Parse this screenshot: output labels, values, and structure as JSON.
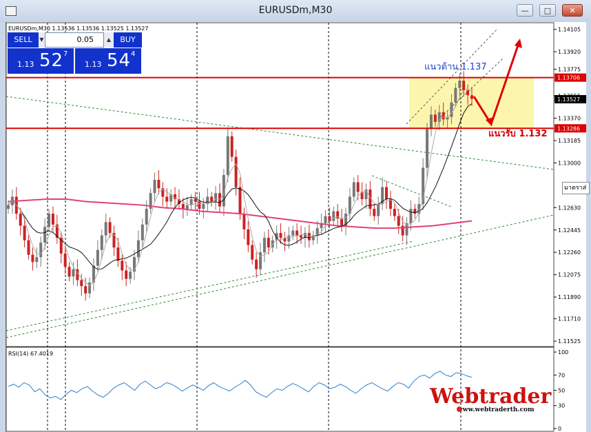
{
  "window": {
    "title": "EURUSDm,M30"
  },
  "trade_panel": {
    "sell_label": "SELL",
    "buy_label": "BUY",
    "lot_value": "0.05",
    "sell_price_small": "1.13",
    "sell_price_big": "52",
    "sell_price_sup": "7",
    "buy_price_small": "1.13",
    "buy_price_big": "54",
    "buy_price_sup": "4"
  },
  "chart_header": "EURUSDm,M30  1.13536 1.13536 1.13525 1.13527",
  "rsi_header": "RSI(14) 67.4019",
  "tooltip_text": "มาตราส่",
  "annotations": {
    "resistance": "แนวต้าน 1.137",
    "support": "แนวรับ 1.132"
  },
  "watermark": {
    "brand": "Webtrader",
    "url": "www.webtraderth.com"
  },
  "colors": {
    "candle_bull": "#777777",
    "candle_bear": "#cc2222",
    "level_line": "#dd0000",
    "zone_fill": "#fbf3a0",
    "ma_pink": "#e0407a",
    "rsi_line": "#2a7fd0",
    "label_blue": "#1a44cc",
    "label_red": "#cc0000"
  },
  "chart_data": {
    "type": "candlestick",
    "symbol": "EURUSDm",
    "timeframe": "M30",
    "ohlc_header": {
      "open": 1.13536,
      "high": 1.13536,
      "low": 1.13525,
      "close": 1.13527
    },
    "y_ticks": [
      "1.14105",
      "1.13920",
      "1.13775",
      "1.13555",
      "1.13370",
      "1.13185",
      "1.13000",
      "1.12630",
      "1.12445",
      "1.12260",
      "1.12075",
      "1.11890",
      "1.11710",
      "1.11525"
    ],
    "ylim": [
      1.1148,
      1.1416
    ],
    "levels": [
      {
        "label": "1.13706",
        "value": 1.13706
      },
      {
        "label": "1.13286",
        "value": 1.13286
      }
    ],
    "current_price": {
      "label": "1.13527",
      "value": 1.13527
    },
    "zone": {
      "from": 1.13286,
      "to": 1.13706
    },
    "close_path": [
      1.1265,
      1.1272,
      1.1258,
      1.1248,
      1.1236,
      1.1224,
      1.1218,
      1.1222,
      1.1234,
      1.1247,
      1.1258,
      1.1249,
      1.1238,
      1.1225,
      1.1214,
      1.1206,
      1.1212,
      1.1203,
      1.1198,
      1.1192,
      1.1201,
      1.1215,
      1.1228,
      1.124,
      1.1251,
      1.1242,
      1.123,
      1.1219,
      1.1211,
      1.1204,
      1.121,
      1.1222,
      1.1236,
      1.1249,
      1.1262,
      1.1275,
      1.1286,
      1.1279,
      1.1272,
      1.1268,
      1.1274,
      1.127,
      1.1266,
      1.1262,
      1.1265,
      1.127,
      1.1268,
      1.1262,
      1.1266,
      1.1272,
      1.1268,
      1.1275,
      1.1264,
      1.129,
      1.1322,
      1.1305,
      1.128,
      1.1258,
      1.1245,
      1.1232,
      1.122,
      1.1212,
      1.1226,
      1.1238,
      1.123,
      1.1236,
      1.1242,
      1.1238,
      1.1235,
      1.124,
      1.1244,
      1.124,
      1.1238,
      1.1242,
      1.1236,
      1.124,
      1.1246,
      1.125,
      1.1256,
      1.1252,
      1.126,
      1.1254,
      1.1248,
      1.1258,
      1.1272,
      1.1284,
      1.1276,
      1.127,
      1.1278,
      1.1262,
      1.1256,
      1.1266,
      1.128,
      1.127,
      1.1262,
      1.1256,
      1.1248,
      1.124,
      1.125,
      1.1262,
      1.1258,
      1.1266,
      1.1296,
      1.1328,
      1.134,
      1.1334,
      1.1342,
      1.1336,
      1.1338,
      1.135,
      1.1362,
      1.1368,
      1.136,
      1.1356,
      1.1353
    ],
    "ma_pink": [
      1.1268,
      1.1269,
      1.127,
      1.127,
      1.1268,
      1.1267,
      1.1266,
      1.1265,
      1.1263,
      1.1262,
      1.126,
      1.1259,
      1.1258,
      1.1256,
      1.1254,
      1.1252,
      1.125,
      1.1248,
      1.1247,
      1.1246,
      1.1246,
      1.1247,
      1.1248,
      1.125,
      1.1252
    ],
    "rsi": {
      "period": 14,
      "value": 67.4019,
      "ticks": [
        "100",
        "70",
        "50",
        "30",
        "0"
      ],
      "ylim": [
        0,
        100
      ],
      "values": [
        55,
        58,
        54,
        60,
        57,
        48,
        52,
        44,
        40,
        42,
        38,
        45,
        50,
        47,
        52,
        55,
        49,
        44,
        41,
        46,
        53,
        57,
        60,
        55,
        50,
        58,
        62,
        57,
        52,
        55,
        60,
        58,
        54,
        49,
        53,
        57,
        54,
        50,
        56,
        60,
        55,
        52,
        49,
        54,
        58,
        63,
        57,
        48,
        44,
        41,
        47,
        52,
        50,
        55,
        59,
        56,
        52,
        48,
        55,
        60,
        57,
        52,
        54,
        58,
        55,
        50,
        46,
        52,
        57,
        60,
        56,
        52,
        49,
        55,
        60,
        58,
        53,
        62,
        68,
        70,
        66,
        72,
        75,
        70,
        68,
        73,
        72,
        69,
        67
      ]
    }
  }
}
